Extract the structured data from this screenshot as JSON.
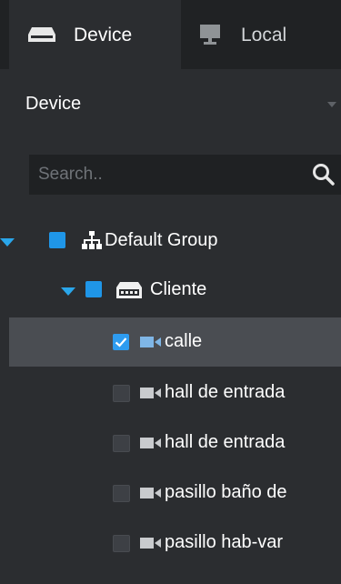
{
  "tabs": [
    {
      "label": "Device",
      "icon": "device-icon",
      "active": true
    },
    {
      "label": "Local",
      "icon": "monitor-icon",
      "active": false
    }
  ],
  "device_select": {
    "value": "Device"
  },
  "search": {
    "placeholder": "Search.."
  },
  "tree": {
    "group": {
      "label": "Default Group",
      "icon": "org-chart-icon",
      "checkbox": "partial"
    },
    "client": {
      "label": "Cliente",
      "icon": "dvr-icon",
      "checkbox": "partial"
    },
    "cameras": [
      {
        "label": "calle",
        "checked": true,
        "selected": true
      },
      {
        "label": "hall de entrada",
        "checked": false,
        "selected": false
      },
      {
        "label": "hall de entrada",
        "checked": false,
        "selected": false
      },
      {
        "label": "pasillo baño de",
        "checked": false,
        "selected": false
      },
      {
        "label": "pasillo hab-var",
        "checked": false,
        "selected": false
      }
    ]
  },
  "colors": {
    "accent": "#1f96e8",
    "background": "#2b2d30",
    "camera_icon": "#c9cbce",
    "selected_camera_icon": "#7fb6e6"
  }
}
